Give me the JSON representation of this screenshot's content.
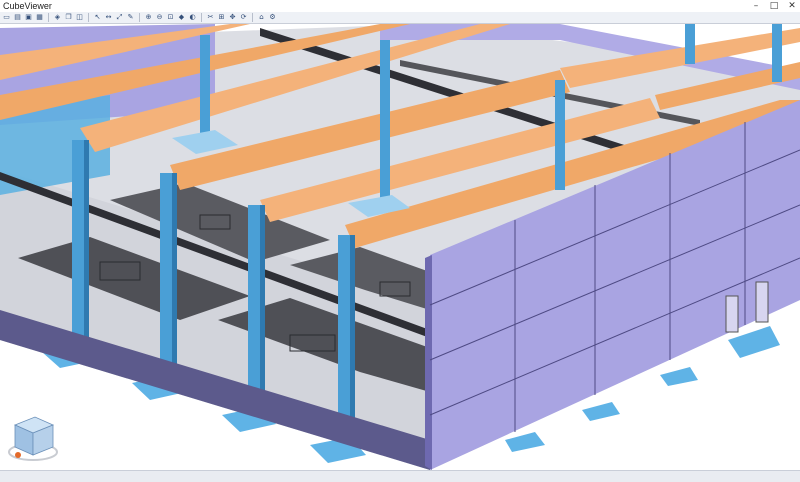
{
  "window": {
    "title": "CubeViewer",
    "minimize": "–",
    "maximize": "□",
    "close": "✕"
  },
  "toolbar": {
    "groups": [
      [
        {
          "icon": "new-icon",
          "glyph": "▭"
        },
        {
          "icon": "open-icon",
          "glyph": "▤"
        },
        {
          "icon": "save-icon",
          "glyph": "▣"
        },
        {
          "icon": "print-icon",
          "glyph": "▦"
        }
      ],
      [
        {
          "icon": "cube-icon",
          "glyph": "◈"
        },
        {
          "icon": "copy-icon",
          "glyph": "❐"
        },
        {
          "icon": "layers-icon",
          "glyph": "◫"
        }
      ],
      [
        {
          "icon": "select-icon",
          "glyph": "↖"
        },
        {
          "icon": "dimension-icon",
          "glyph": "↔"
        },
        {
          "icon": "measure-icon",
          "glyph": "⤢"
        },
        {
          "icon": "annotate-icon",
          "glyph": "✎"
        }
      ],
      [
        {
          "icon": "zoom-in-icon",
          "glyph": "⊕"
        },
        {
          "icon": "zoom-out-icon",
          "glyph": "⊖"
        },
        {
          "icon": "zoom-fit-icon",
          "glyph": "⊡"
        },
        {
          "icon": "view-cube-icon",
          "glyph": "◆"
        },
        {
          "icon": "shade-icon",
          "glyph": "◐"
        }
      ],
      [
        {
          "icon": "cut-icon",
          "glyph": "✂"
        },
        {
          "icon": "section-icon",
          "glyph": "⊞"
        },
        {
          "icon": "pan-icon",
          "glyph": "✥"
        },
        {
          "icon": "rotate-icon",
          "glyph": "⟳"
        }
      ],
      [
        {
          "icon": "home-icon",
          "glyph": "⌂"
        },
        {
          "icon": "settings-icon",
          "glyph": "⚙"
        }
      ]
    ]
  },
  "colors": {
    "wall": "#a9a4e2",
    "wall_dark": "#8f8acc",
    "beam": "#f3b27a",
    "column": "#4a9fd6",
    "footing": "#8fc6ea",
    "slab": "#55565b",
    "floor": "#d9dbe1"
  }
}
